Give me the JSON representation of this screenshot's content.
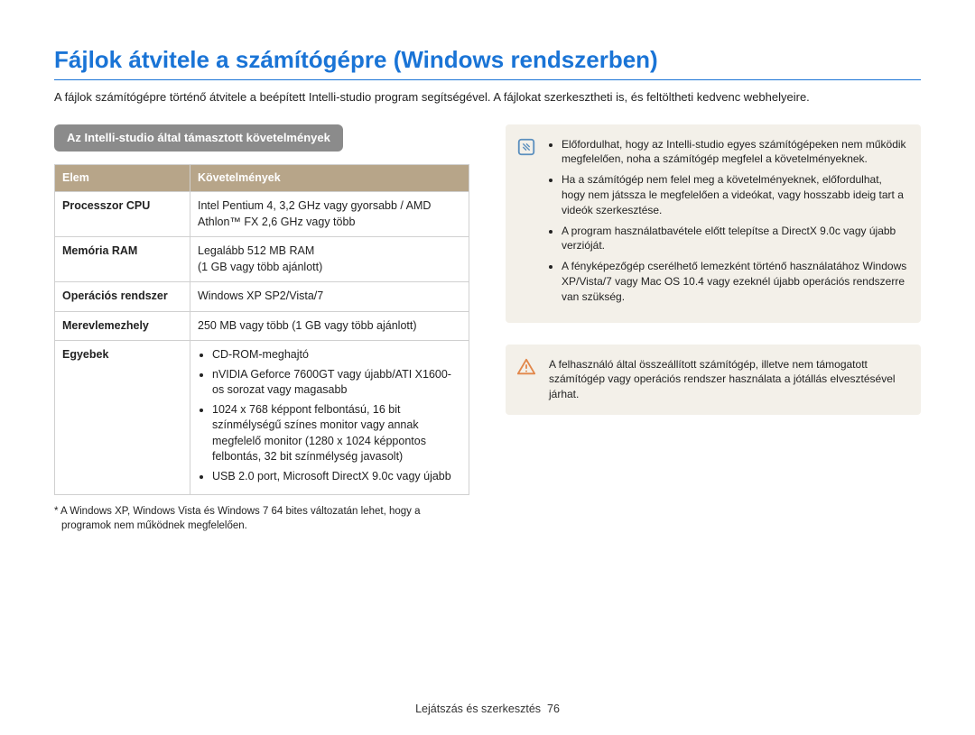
{
  "title": "Fájlok átvitele a számítógépre (Windows rendszerben)",
  "intro": "A fájlok számítógépre történő átvitele a beépített Intelli-studio program segítségével. A fájlokat szerkesztheti is, és feltöltheti kedvenc webhelyeire.",
  "section_label": "Az Intelli-studio által támasztott követelmények",
  "table": {
    "headers": {
      "col1": "Elem",
      "col2": "Követelmények"
    },
    "rows": {
      "cpu": {
        "label": "Processzor CPU",
        "value": "Intel Pentium 4, 3,2 GHz vagy gyorsabb / AMD Athlon™ FX 2,6 GHz vagy több"
      },
      "ram": {
        "label": "Memória RAM",
        "value": "Legalább 512 MB RAM\n(1 GB vagy több ajánlott)"
      },
      "os": {
        "label": "Operációs rendszer",
        "value": "Windows XP SP2/Vista/7"
      },
      "hdd": {
        "label": "Merevlemezhely",
        "value": "250 MB vagy több (1 GB vagy több ajánlott)"
      },
      "other": {
        "label": "Egyebek",
        "items": [
          "CD-ROM-meghajtó",
          "nVIDIA Geforce 7600GT vagy újabb/ATI X1600-os sorozat vagy magasabb",
          "1024 x 768 képpont felbontású, 16 bit színmélységű színes monitor vagy annak megfelelő monitor (1280 x 1024 képpontos felbontás, 32 bit színmélység javasolt)",
          "USB 2.0 port, Microsoft DirectX 9.0c vagy újabb"
        ]
      }
    }
  },
  "footnote": "* A Windows XP, Windows Vista és Windows 7 64 bites változatán lehet, hogy a programok nem működnek megfelelően.",
  "info_notes": [
    "Előfordulhat, hogy az Intelli-studio egyes számítógépeken nem működik megfelelően, noha a számítógép megfelel a követelményeknek.",
    "Ha a számítógép nem felel meg a követelményeknek, előfordulhat, hogy nem játssza le megfelelően a videókat, vagy hosszabb ideig tart a videók szerkesztése.",
    "A program használatbavétele előtt telepítse a DirectX 9.0c vagy újabb verzióját.",
    "A fényképezőgép cserélhető lemezként történő használatához Windows XP/Vista/7 vagy Mac OS 10.4 vagy ezeknél újabb operációs rendszerre van szükség."
  ],
  "warning_note": "A felhasználó által összeállított számítógép, illetve nem támogatott számítógép vagy operációs rendszer használata a jótállás elvesztésével járhat.",
  "footer": {
    "section": "Lejátszás és szerkesztés",
    "page": "76"
  }
}
